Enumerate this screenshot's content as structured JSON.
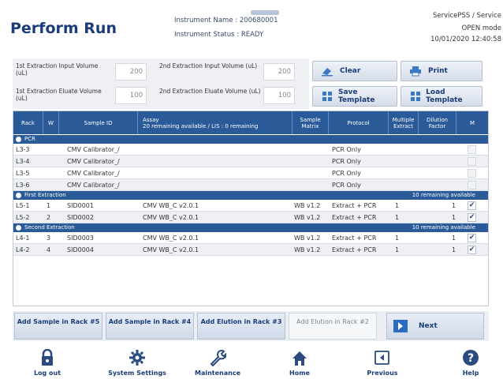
{
  "header": {
    "title": "Perform Run",
    "instrument_name": "Instrument Name : 200680001",
    "instrument_status": "Instrument Status : READY",
    "service_user": "ServicePSS / Service",
    "mode": "OPEN mode",
    "datetime": "10/01/2020 12:40:58"
  },
  "volumes": {
    "first_input_label": "1st Extraction Input Volume (uL)",
    "first_input_value": "200",
    "second_input_label": "2nd Extraction Input Volume (uL)",
    "second_input_value": "200",
    "first_eluate_label": "1st Extraction Eluate Volume (uL)",
    "first_eluate_value": "100",
    "second_eluate_label": "2nd Extraction Eluate Volume (uL)",
    "second_eluate_value": "100"
  },
  "actions": {
    "clear": "Clear",
    "print": "Print",
    "save_template": "Save Template",
    "load_template": "Load Template"
  },
  "table": {
    "headers": {
      "rack": "Rack",
      "w": "W",
      "sample_id": "Sample ID",
      "assay": "Assay",
      "assay_sub": "20 remaining available / LIS : 0 remaining",
      "sample_matrix": "Sample Matrix",
      "protocol": "Protocol",
      "multiple_extract": "Multiple Extract",
      "dilution_factor": "Dilution Factor",
      "m": "M"
    },
    "groups": [
      {
        "name": "PCR",
        "remaining": "",
        "rows": [
          {
            "rack": "L3-3",
            "w": "",
            "sample_id": "CMV Calibrator_/",
            "assay": "",
            "matrix": "",
            "protocol": "PCR Only",
            "multi": "",
            "dilution": "",
            "checked": false
          },
          {
            "rack": "L3-4",
            "w": "",
            "sample_id": "CMV Calibrator_/",
            "assay": "",
            "matrix": "",
            "protocol": "PCR Only",
            "multi": "",
            "dilution": "",
            "checked": false
          },
          {
            "rack": "L3-5",
            "w": "",
            "sample_id": "CMV Calibrator_/",
            "assay": "",
            "matrix": "",
            "protocol": "PCR Only",
            "multi": "",
            "dilution": "",
            "checked": false
          },
          {
            "rack": "L3-6",
            "w": "",
            "sample_id": "CMV Calibrator_/",
            "assay": "",
            "matrix": "",
            "protocol": "PCR Only",
            "multi": "",
            "dilution": "",
            "checked": false
          }
        ]
      },
      {
        "name": "First Extraction",
        "remaining": "10 remaining available",
        "rows": [
          {
            "rack": "L5-1",
            "w": "1",
            "sample_id": "SID0001",
            "assay": "CMV WB_C v2.0.1",
            "matrix": "WB v1.2",
            "protocol": "Extract + PCR",
            "multi": "1",
            "dilution": "1",
            "checked": true
          },
          {
            "rack": "L5-2",
            "w": "2",
            "sample_id": "SID0002",
            "assay": "CMV WB_C v2.0.1",
            "matrix": "WB v1.2",
            "protocol": "Extract + PCR",
            "multi": "1",
            "dilution": "1",
            "checked": true
          }
        ]
      },
      {
        "name": "Second Extraction",
        "remaining": "10 remaining available",
        "rows": [
          {
            "rack": "L4-1",
            "w": "3",
            "sample_id": "SID0003",
            "assay": "CMV WB_C v2.0.1",
            "matrix": "WB v1.2",
            "protocol": "Extract + PCR",
            "multi": "1",
            "dilution": "1",
            "checked": true
          },
          {
            "rack": "L4-2",
            "w": "4",
            "sample_id": "SID0004",
            "assay": "CMV WB_C v2.0.1",
            "matrix": "WB v1.2",
            "protocol": "Extract + PCR",
            "multi": "1",
            "dilution": "1",
            "checked": true
          }
        ]
      }
    ]
  },
  "add_buttons": {
    "rack5": "Add Sample in Rack #5",
    "rack4": "Add Sample in Rack #4",
    "elution3": "Add Elution in Rack #3",
    "elution2": "Add Elution in Rack #2",
    "next": "Next"
  },
  "footer": {
    "logout": "Log out",
    "system_settings": "System Settings",
    "maintenance": "Maintenance",
    "home": "Home",
    "previous": "Previous",
    "help": "Help"
  },
  "colors": {
    "header_blue": "#2a5a97",
    "title_navy": "#1a3c78"
  }
}
